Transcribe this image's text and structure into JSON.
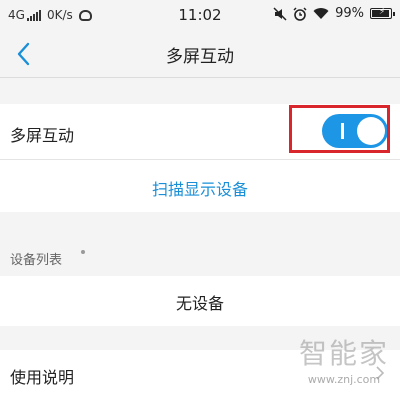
{
  "status_bar": {
    "network": "4G",
    "speed": "0K/s",
    "time": "11:02",
    "battery": "99%",
    "icons": [
      "signal-icon",
      "cloud-icon",
      "mute-icon",
      "alarm-icon",
      "wifi-icon",
      "battery-icon"
    ]
  },
  "nav": {
    "title": "多屏互动",
    "back_icon": "chevron-left-icon"
  },
  "settings": {
    "toggle_label": "多屏互动",
    "toggle_on": true,
    "scan_label": "扫描显示设备",
    "device_list_header": "设备列表",
    "no_device": "无设备",
    "guide_label": "使用说明"
  },
  "watermark": {
    "text": "智能家",
    "url": "www.znj.com"
  },
  "colors": {
    "accent": "#1a8fd8",
    "switch_on": "#1e96e6",
    "highlight": "#d9262c",
    "background": "#f4f4f4"
  }
}
